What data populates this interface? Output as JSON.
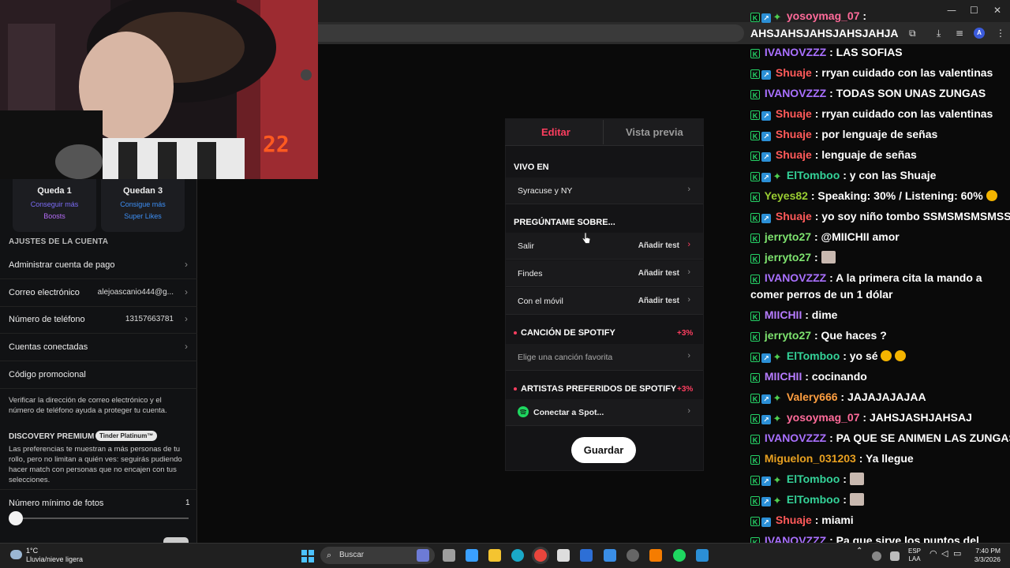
{
  "browser": {
    "window_controls": [
      "—",
      "☐",
      "✕"
    ],
    "profile_initial": "A"
  },
  "webcam": {
    "overlay_number": "22"
  },
  "left_panel": {
    "boost_cards": [
      {
        "title": "Queda 1",
        "line1": "Conseguir más",
        "line2": "Boosts",
        "color1": "#7b6cf6",
        "color2": "#b36cf6"
      },
      {
        "title": "Quedan 3",
        "line1": "Consigue más",
        "line2": "Super Likes",
        "color1": "#3d8ff5",
        "color2": "#3d8ff5"
      }
    ],
    "section_title": "AJUSTES DE LA CUENTA",
    "rows": [
      {
        "label": "Administrar cuenta de pago",
        "value": "",
        "chevron": "›"
      },
      {
        "label": "Correo electrónico",
        "value": "alejoascanio444@g...",
        "chevron": "›"
      },
      {
        "label": "Número de teléfono",
        "value": "13157663781",
        "chevron": "›"
      },
      {
        "label": "Cuentas conectadas",
        "value": "",
        "chevron": "›"
      },
      {
        "label": "Código promocional",
        "value": "",
        "chevron": ""
      }
    ],
    "verify_text": "Verificar la dirección de correo electrónico y el número de teléfono ayuda a proteger tu cuenta.",
    "discovery_title": "DISCOVERY PREMIUM",
    "discovery_badge": "Tinder Platinum™",
    "discovery_text": "Las preferencias te muestran a más personas de tu rollo, pero no limitan a quién ves: seguirás pudiendo hacer match con personas que no encajen con tus selecciones.",
    "min_photos_label": "Número mínimo de fotos",
    "min_photos_value": "1",
    "min_photos_fraction": 0.0
  },
  "editor": {
    "tabs": [
      {
        "label": "Editar",
        "active": true
      },
      {
        "label": "Vista previa",
        "active": false
      }
    ],
    "live_in_title": "VIVO EN",
    "live_in_value": "Syracuse y NY",
    "ask_me_title": "PREGÚNTAME SOBRE...",
    "ask_rows": [
      {
        "label": "Salir",
        "action": "Añadir test"
      },
      {
        "label": "Findes",
        "action": "Añadir test"
      },
      {
        "label": "Con el móvil",
        "action": "Añadir test"
      }
    ],
    "song_title": "CANCIÓN DE SPOTIFY",
    "song_bonus": "+3%",
    "song_placeholder": "Elige una canción favorita",
    "artists_title": "ARTISTAS PREFERIDOS DE SPOTIFY",
    "artists_bonus": "+3%",
    "connect_label": "Conectar a Spot...",
    "save_label": "Guardar",
    "chevron": "›",
    "accent_color": "#fd3e5f"
  },
  "chat": {
    "messages": [
      {
        "badges": [
          "k",
          "s",
          "g"
        ],
        "user": "yosoymag_07",
        "color": "#ff6b9a",
        "text": ":"
      },
      {
        "badges": [],
        "user": "",
        "color": "#fff",
        "text": "AHSJAHSJAHSJAHSJAHJA"
      },
      {
        "badges": [
          "k"
        ],
        "user": "IVANOVZZZ",
        "color": "#a970ff",
        "text": ": LAS SOFIAS"
      },
      {
        "badges": [
          "k",
          "s"
        ],
        "user": "Shuaje",
        "color": "#ff5a5a",
        "text": ": rryan cuidado con las valentinas"
      },
      {
        "badges": [
          "k"
        ],
        "user": "IVANOVZZZ",
        "color": "#a970ff",
        "text": ": TODAS SON UNAS ZUNGAS"
      },
      {
        "badges": [
          "k",
          "s"
        ],
        "user": "Shuaje",
        "color": "#ff5a5a",
        "text": ": rryan cuidado con las valentinas"
      },
      {
        "badges": [
          "k",
          "s"
        ],
        "user": "Shuaje",
        "color": "#ff5a5a",
        "text": ": por lenguaje de señas"
      },
      {
        "badges": [
          "k",
          "s"
        ],
        "user": "Shuaje",
        "color": "#ff5a5a",
        "text": ": lenguaje de señas"
      },
      {
        "badges": [
          "k",
          "s",
          "g"
        ],
        "user": "ElTomboo",
        "color": "#34d399",
        "text": ": y con las Shuaje"
      },
      {
        "badges": [
          "k"
        ],
        "user": "Yeyes82",
        "color": "#9acd32",
        "text": ": Speaking: 30% / Listening: 60%"
      },
      {
        "badges": [
          "k",
          "s"
        ],
        "user": "Shuaje",
        "color": "#ff5a5a",
        "text": ": yo soy niño tombo SSMSMSMSMSS"
      },
      {
        "badges": [
          "k"
        ],
        "user": "jerryto27",
        "color": "#7ee36f",
        "text": ": @MIICHII amor"
      },
      {
        "badges": [
          "k"
        ],
        "user": "jerryto27",
        "color": "#7ee36f",
        "text": ":"
      },
      {
        "badges": [
          "k"
        ],
        "user": "IVANOVZZZ",
        "color": "#a970ff",
        "text": ": A la primera cita la mando a comer perros de un 1 dólar"
      },
      {
        "badges": [
          "k"
        ],
        "user": "MIICHII",
        "color": "#b77cff",
        "text": ": dime"
      },
      {
        "badges": [
          "k"
        ],
        "user": "jerryto27",
        "color": "#7ee36f",
        "text": ": Que haces ?"
      },
      {
        "badges": [
          "k",
          "s",
          "g"
        ],
        "user": "ElTomboo",
        "color": "#34d399",
        "text": ": yo sé"
      },
      {
        "badges": [
          "k"
        ],
        "user": "MIICHII",
        "color": "#b77cff",
        "text": ": cocinando"
      },
      {
        "badges": [
          "k",
          "s",
          "g"
        ],
        "user": "Valery666",
        "color": "#ff9f40",
        "text": ": JAJAJAJAJAA"
      },
      {
        "badges": [
          "k",
          "s",
          "g"
        ],
        "user": "yosoymag_07",
        "color": "#ff6b9a",
        "text": ": JAHSJASHJAHSAJ"
      },
      {
        "badges": [
          "k"
        ],
        "user": "IVANOVZZZ",
        "color": "#a970ff",
        "text": ": PA QUE SE ANIMEN LAS ZUNGAS"
      },
      {
        "badges": [
          "k"
        ],
        "user": "Miguelon_031203",
        "color": "#e8a020",
        "text": ": Ya llegue"
      },
      {
        "badges": [
          "k",
          "s",
          "g"
        ],
        "user": "ElTomboo",
        "color": "#34d399",
        "text": ":"
      },
      {
        "badges": [
          "k",
          "s",
          "g"
        ],
        "user": "ElTomboo",
        "color": "#34d399",
        "text": ":"
      },
      {
        "badges": [
          "k",
          "s"
        ],
        "user": "Shuaje",
        "color": "#ff5a5a",
        "text": ": miami"
      },
      {
        "badges": [
          "k"
        ],
        "user": "IVANOVZZZ",
        "color": "#a970ff",
        "text": ": Pa que sirve los puntos del canal gente"
      }
    ]
  },
  "taskbar": {
    "weather_temp": "1°C",
    "weather_desc": "Lluvia/nieve ligera",
    "search_placeholder": "Buscar",
    "lang_top": "ESP",
    "lang_bottom": "LAA",
    "time": "7:40 PM",
    "date": "3/3/2026"
  }
}
